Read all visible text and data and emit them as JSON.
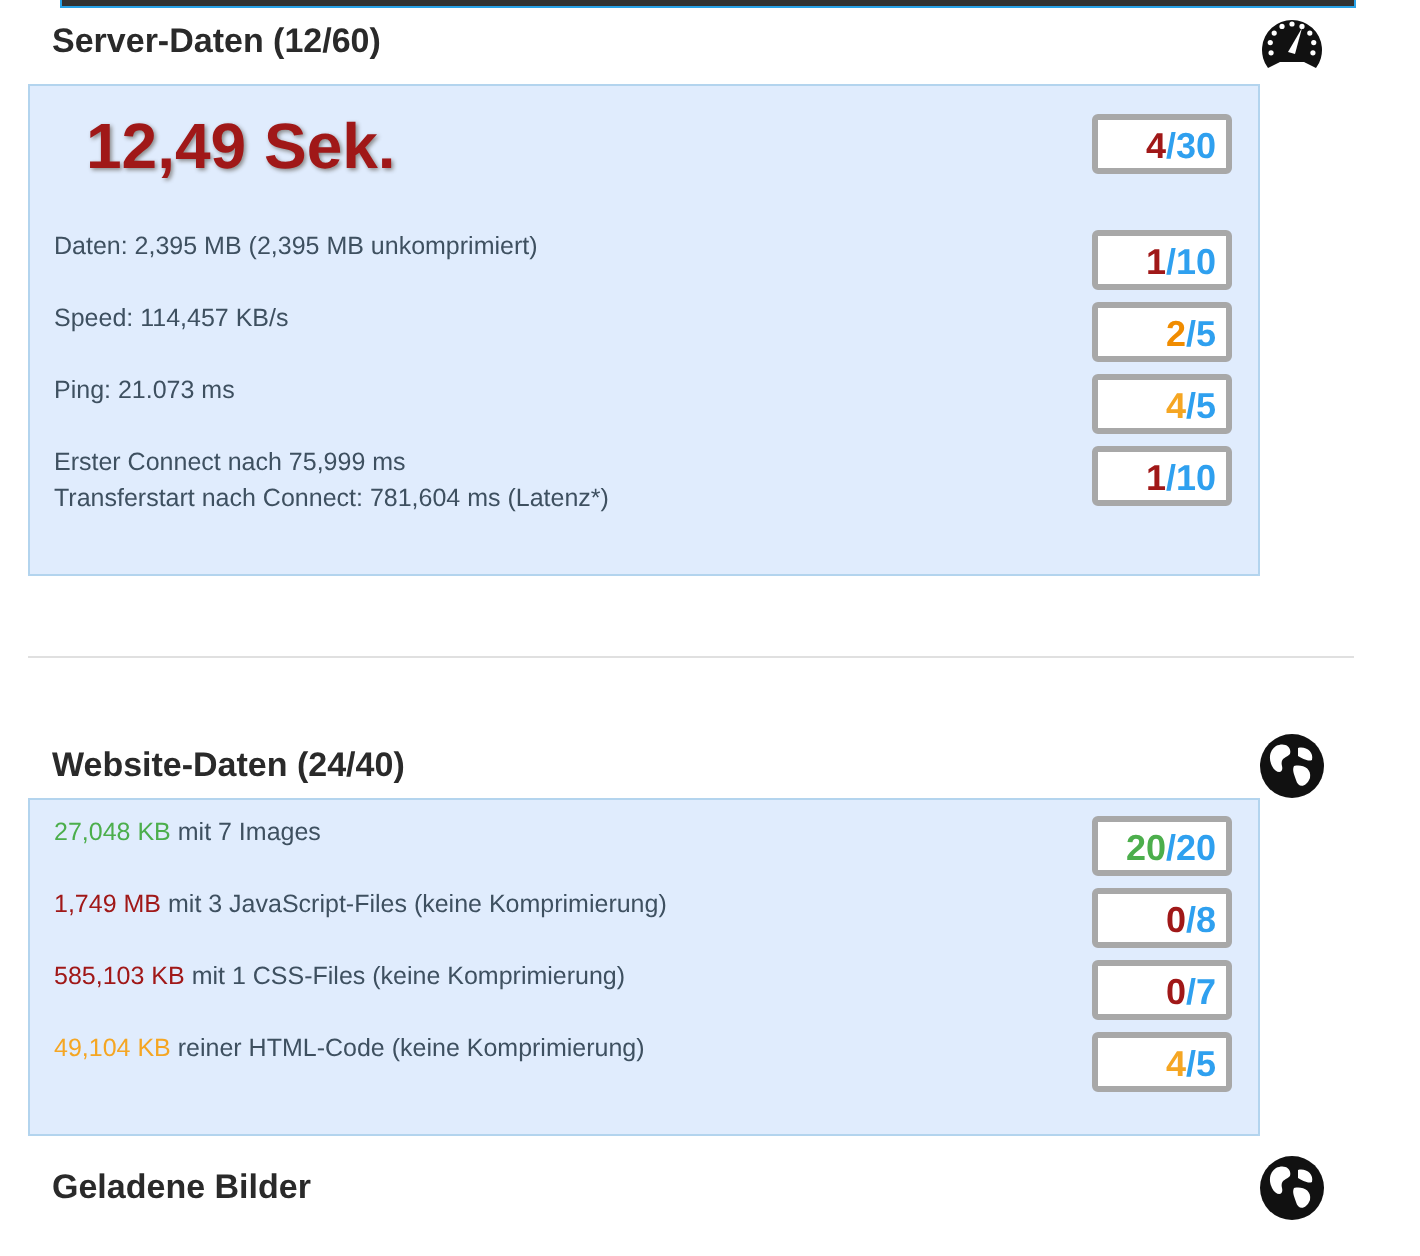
{
  "sections": [
    {
      "title": "Server-Daten (12/60)",
      "headline": {
        "text": "12,49 Sek.",
        "score": {
          "points": "4",
          "max": "/30",
          "color": "#a01818"
        }
      },
      "rows": [
        {
          "lines": [
            "Daten: 2,395 MB (2,395 MB unkomprimiert)"
          ],
          "score": {
            "points": "1",
            "max": "/10",
            "color": "#a01818"
          }
        },
        {
          "lines": [
            "Speed: 114,457 KB/s"
          ],
          "score": {
            "points": "2",
            "max": "/5",
            "color": "#f08c00"
          }
        },
        {
          "lines": [
            "Ping: 21.073 ms"
          ],
          "score": {
            "points": "4",
            "max": "/5",
            "color": "#f5a623"
          }
        },
        {
          "lines": [
            "Erster Connect nach 75,999 ms",
            "Transferstart nach Connect: 781,604 ms (Latenz*)"
          ],
          "score": {
            "points": "1",
            "max": "/10",
            "color": "#a01818"
          }
        }
      ]
    },
    {
      "title": "Website-Daten (24/40)",
      "rows": [
        {
          "highlight": {
            "text": "27,048 KB",
            "color": "#4cae4c"
          },
          "lines": [
            "mit 7 Images"
          ],
          "score": {
            "points": "20",
            "max": "/20",
            "color": "#4cae4c"
          }
        },
        {
          "highlight": {
            "text": "1,749 MB",
            "color": "#a01818"
          },
          "lines": [
            "mit 3 JavaScript-Files (keine Komprimierung)"
          ],
          "score": {
            "points": "0",
            "max": "/8",
            "color": "#a01818"
          }
        },
        {
          "highlight": {
            "text": "585,103 KB",
            "color": "#a01818"
          },
          "lines": [
            "mit 1 CSS-Files (keine Komprimierung)"
          ],
          "score": {
            "points": "0",
            "max": "/7",
            "color": "#a01818"
          }
        },
        {
          "highlight": {
            "text": "49,104 KB",
            "color": "#f5a623"
          },
          "lines": [
            "reiner HTML-Code (keine Komprimierung)"
          ],
          "score": {
            "points": "4",
            "max": "/5",
            "color": "#f5a623"
          }
        }
      ]
    },
    {
      "title": "Geladene Bilder"
    }
  ]
}
